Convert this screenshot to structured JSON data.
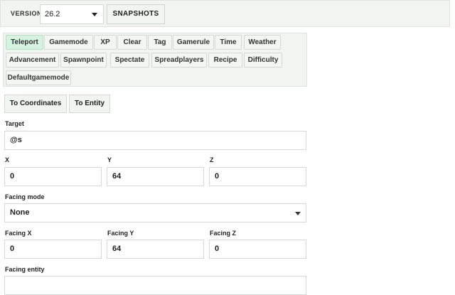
{
  "header": {
    "version_label": "VERSION",
    "version_value": "26.2",
    "snapshots_label": "SNAPSHOTS"
  },
  "commands": {
    "active": "Teleport",
    "items": [
      "Teleport",
      "Gamemode",
      "XP",
      "Clear",
      "Tag",
      "Gamerule",
      "Time",
      "Weather",
      "Advancement",
      "Spawnpoint",
      "Spectate",
      "Spreadplayers",
      "Recipe",
      "Difficulty",
      "Defaultgamemode"
    ]
  },
  "mode_tabs": [
    "To Coordinates",
    "To Entity"
  ],
  "form": {
    "target_label": "Target",
    "target_value": "@s",
    "x_label": "X",
    "x_value": "0",
    "y_label": "Y",
    "y_value": "64",
    "z_label": "Z",
    "z_value": "0",
    "facing_mode_label": "Facing mode",
    "facing_mode_value": "None",
    "facing_x_label": "Facing X",
    "facing_x_value": "0",
    "facing_y_label": "Facing Y",
    "facing_y_value": "64",
    "facing_z_label": "Facing Z",
    "facing_z_value": "0",
    "facing_entity_label": "Facing entity"
  }
}
